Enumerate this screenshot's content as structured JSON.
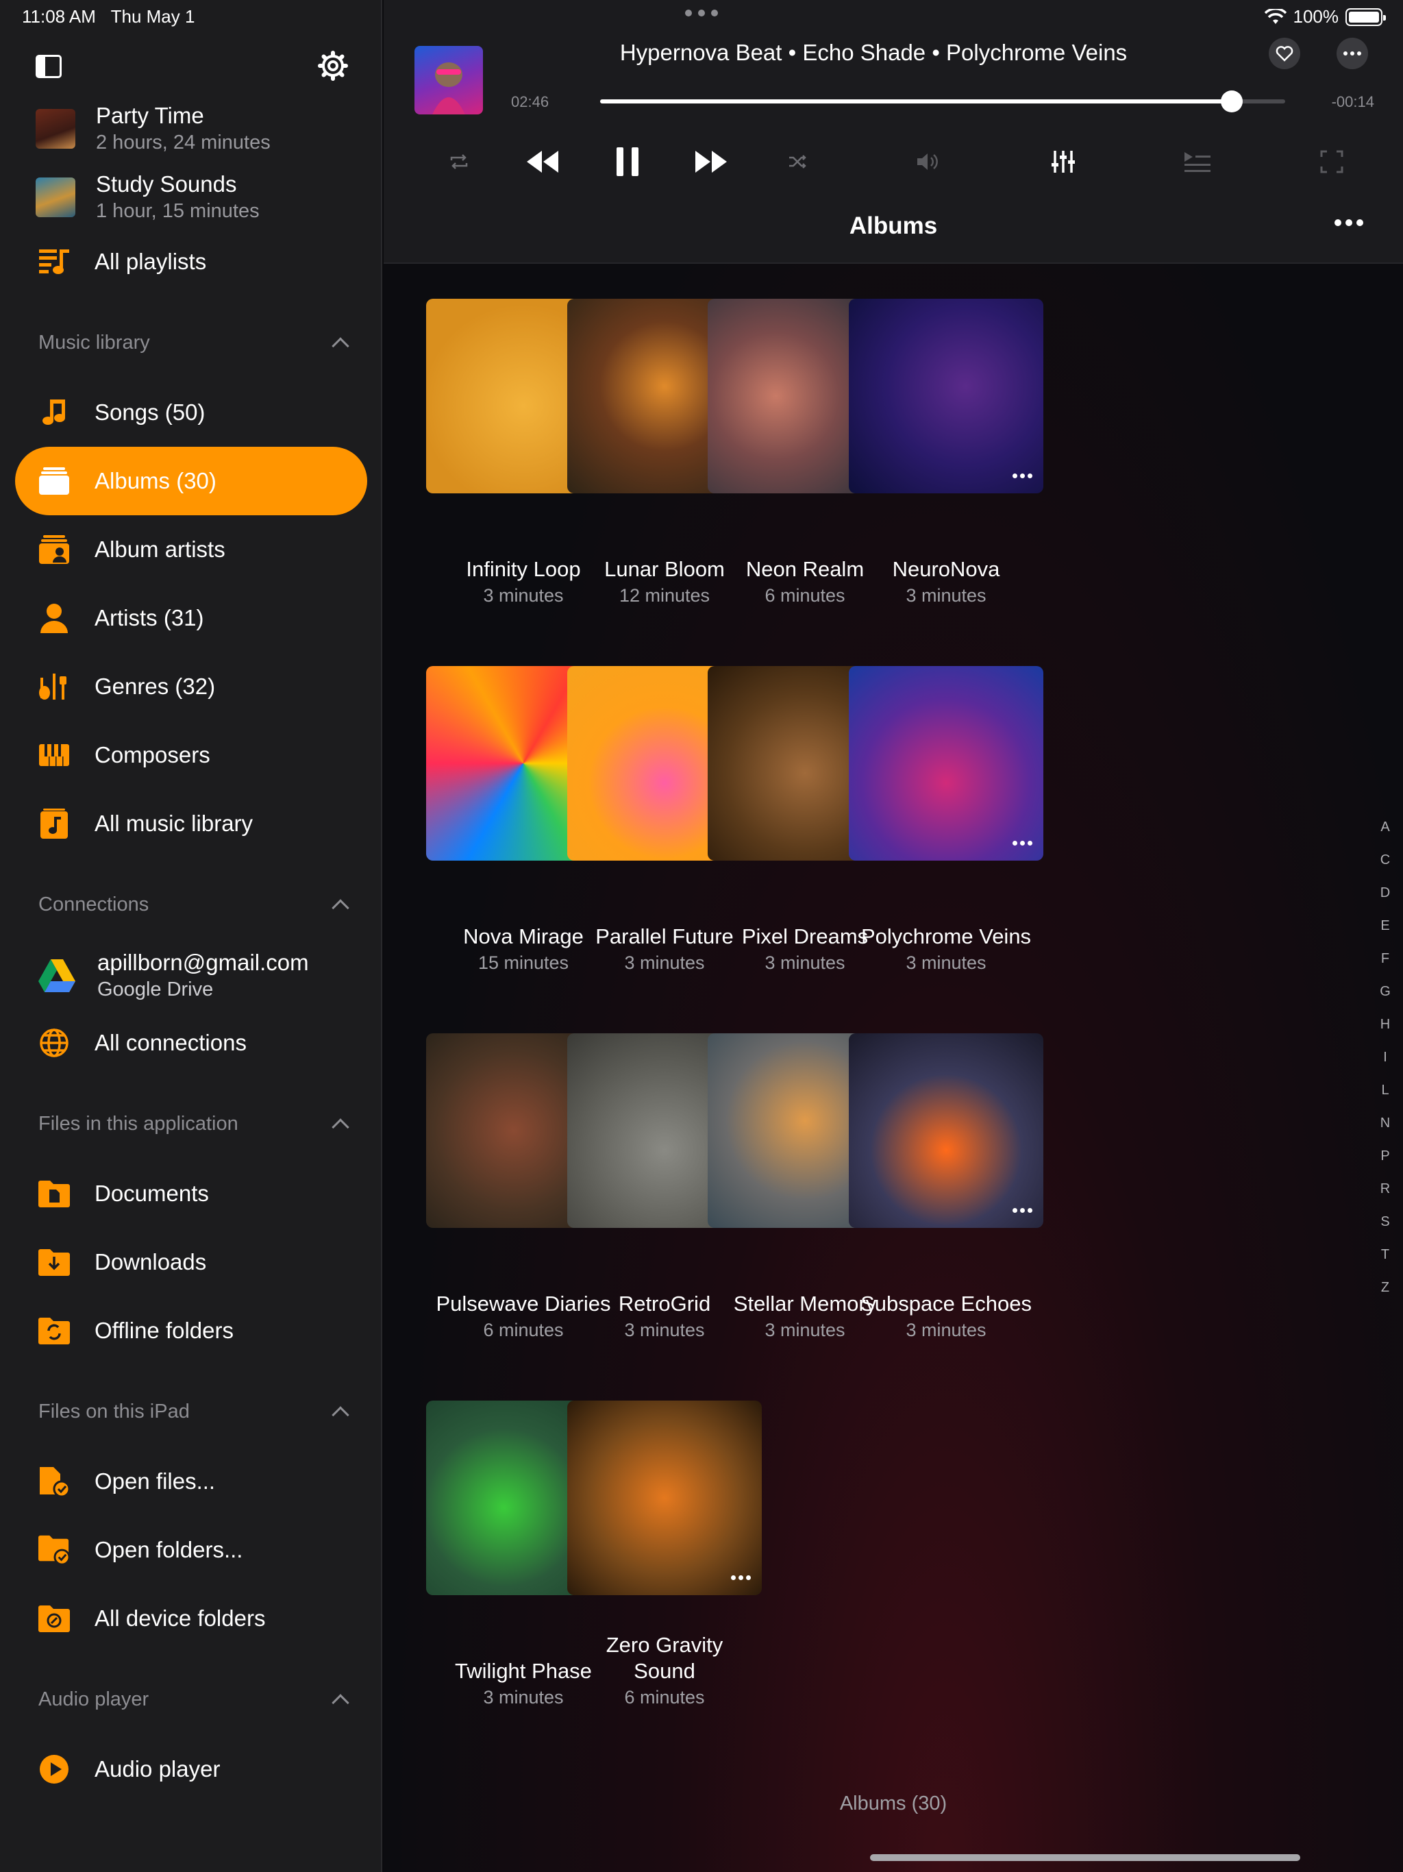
{
  "status_bar": {
    "time": "11:08 AM",
    "date": "Thu May 1",
    "battery": "100%",
    "battery_level": 1.0
  },
  "sidebar": {
    "playlists": [
      {
        "title": "Party Time",
        "subtitle": "2 hours, 24 minutes"
      },
      {
        "title": "Study Sounds",
        "subtitle": "1 hour, 15 minutes"
      }
    ],
    "all_playlists": "All playlists",
    "music_library": {
      "header": "Music library",
      "items": [
        {
          "label": "Songs (50)",
          "icon": "music-note-icon"
        },
        {
          "label": "Albums (30)",
          "icon": "album-stack-icon",
          "active": true
        },
        {
          "label": "Album artists",
          "icon": "album-artist-icon"
        },
        {
          "label": "Artists (31)",
          "icon": "person-icon"
        },
        {
          "label": "Genres (32)",
          "icon": "instruments-icon"
        },
        {
          "label": "Composers",
          "icon": "piano-icon"
        },
        {
          "label": "All music library",
          "icon": "music-library-icon"
        }
      ]
    },
    "connections": {
      "header": "Connections",
      "account_email": "apillborn@gmail.com",
      "account_service": "Google Drive",
      "all_connections": "All connections"
    },
    "files_app": {
      "header": "Files in this application",
      "items": [
        "Documents",
        "Downloads",
        "Offline folders"
      ]
    },
    "files_ipad": {
      "header": "Files on this iPad",
      "items": [
        "Open files...",
        "Open folders...",
        "All device folders"
      ]
    },
    "audio_player": {
      "header": "Audio player",
      "item": "Audio player"
    }
  },
  "player": {
    "now_playing": "Hypernova Beat • Echo Shade • Polychrome Veins",
    "elapsed": "02:46",
    "remaining": "-00:14",
    "progress": 0.922
  },
  "albums": {
    "header": "Albums",
    "footer": "Albums (30)",
    "items": [
      {
        "title": "Infinity Loop",
        "duration": "3 minutes"
      },
      {
        "title": "Lunar Bloom",
        "duration": "12 minutes"
      },
      {
        "title": "Neon Realm",
        "duration": "6 minutes"
      },
      {
        "title": "NeuroNova",
        "duration": "3 minutes"
      },
      {
        "title": "Nova Mirage",
        "duration": "15 minutes"
      },
      {
        "title": "Parallel Future",
        "duration": "3 minutes"
      },
      {
        "title": "Pixel Dreams",
        "duration": "3 minutes"
      },
      {
        "title": "Polychrome Veins",
        "duration": "3 minutes"
      },
      {
        "title": "Pulsewave Diaries",
        "duration": "6 minutes"
      },
      {
        "title": "RetroGrid",
        "duration": "3 minutes"
      },
      {
        "title": "Stellar Memory",
        "duration": "3 minutes"
      },
      {
        "title": "Subspace Echoes",
        "duration": "3 minutes"
      },
      {
        "title": "Twilight Phase",
        "duration": "3 minutes"
      },
      {
        "title": "Zero Gravity Sound",
        "duration": "6 minutes"
      }
    ]
  },
  "az_index": [
    "A",
    "C",
    "D",
    "E",
    "F",
    "G",
    "H",
    "I",
    "L",
    "N",
    "P",
    "R",
    "S",
    "T",
    "Z"
  ],
  "colors": {
    "accent": "#ff9500",
    "sidebar_bg": "#1c1c1e",
    "player_bg": "#1b1b1e"
  }
}
